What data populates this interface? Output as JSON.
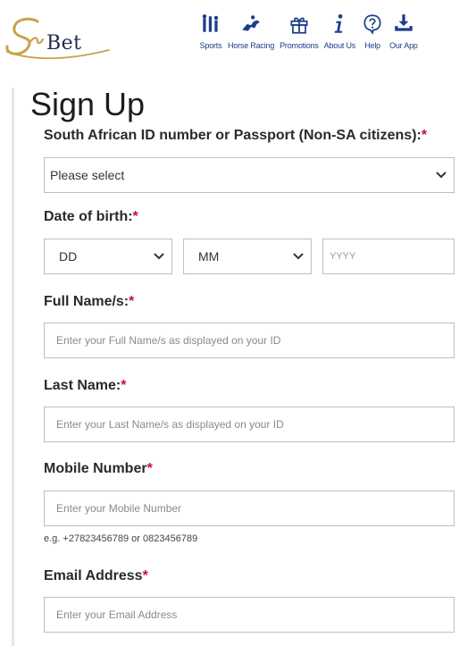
{
  "brand": {
    "name": "Bet",
    "script_mark": "Sun"
  },
  "nav": [
    {
      "label": "Sports",
      "icon": "sports-icon"
    },
    {
      "label": "Horse Racing",
      "icon": "horse-racing-icon"
    },
    {
      "label": "Promotions",
      "icon": "gift-icon"
    },
    {
      "label": "About Us",
      "icon": "info-icon"
    },
    {
      "label": "Help",
      "icon": "help-icon"
    },
    {
      "label": "Our App",
      "icon": "download-icon"
    }
  ],
  "page_title": "Sign Up",
  "fields": {
    "id_type": {
      "label": "South African ID number or Passport (Non-SA citizens):",
      "required": "*",
      "value": "Please select"
    },
    "dob": {
      "label": "Date of birth:",
      "required": "*",
      "day": "DD",
      "month": "MM",
      "year_placeholder": "YYYY"
    },
    "full_name": {
      "label": "Full Name/s:",
      "required": "*",
      "placeholder": "Enter your Full Name/s as displayed on your ID"
    },
    "last_name": {
      "label": "Last Name:",
      "required": "*",
      "placeholder": "Enter your Last Name/s as displayed on your ID"
    },
    "mobile": {
      "label": "Mobile Number",
      "required": "*",
      "placeholder": "Enter your Mobile Number",
      "hint": "e.g. +27823456789 or 0823456789"
    },
    "email": {
      "label": "Email Address",
      "required": "*",
      "placeholder": "Enter your Email Address"
    }
  },
  "colors": {
    "required": "#c8102e",
    "nav": "#1c3d8a",
    "border": "#bfbfbf"
  }
}
